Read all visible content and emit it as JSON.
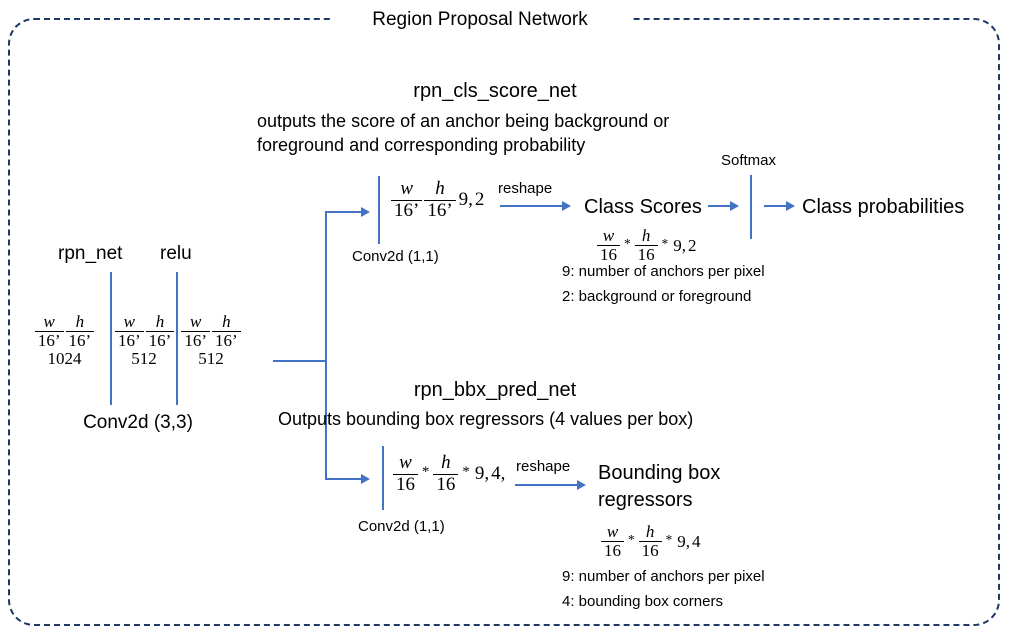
{
  "diagram": {
    "title": "Region Proposal Network",
    "type": "flow-diagram"
  },
  "backbone": {
    "labels": {
      "rpn_net": "rpn_net",
      "relu": "relu",
      "conv": "Conv2d (3,3)"
    },
    "stages": [
      {
        "name": "input-feature-map",
        "w_num": "w",
        "w_den": "16",
        "h_num": "h",
        "h_den": "16",
        "channels": "1024"
      },
      {
        "name": "rpn-net-output",
        "w_num": "w",
        "w_den": "16",
        "h_num": "h",
        "h_den": "16",
        "channels": "512"
      },
      {
        "name": "relu-output",
        "w_num": "w",
        "w_den": "16",
        "h_num": "h",
        "h_den": "16",
        "channels": "512"
      }
    ]
  },
  "cls_branch": {
    "heading": "rpn_cls_score_net",
    "description_line1": "outputs the score of an anchor being background or",
    "description_line2": "foreground and corresponding probability",
    "conv_label": "Conv2d (1,1)",
    "tensor": {
      "w_num": "w",
      "w_den": "16",
      "h_num": "h",
      "h_den": "16",
      "anchors": "9",
      "classes": "2",
      "sep": ","
    },
    "reshape_label": "reshape",
    "output_label": "Class Scores",
    "output_shape": {
      "w_num": "w",
      "w_den": "16",
      "h_num": "h",
      "h_den": "16",
      "op": "*",
      "anchors": "9",
      "classes": "2"
    },
    "note1": "9: number of anchors per pixel",
    "note2": "2: background or foreground",
    "softmax_label": "Softmax",
    "final_label": "Class probabilities"
  },
  "bbox_branch": {
    "heading": "rpn_bbx_pred_net",
    "description": "Outputs bounding box regressors  (4 values per box)",
    "conv_label": "Conv2d (1,1)",
    "tensor": {
      "w_num": "w",
      "w_den": "16",
      "h_num": "h",
      "h_den": "16",
      "op": "*",
      "anchors": "9",
      "coords": "4",
      "trailing": ","
    },
    "reshape_label": "reshape",
    "output_label_line1": "Bounding box",
    "output_label_line2": "regressors",
    "output_shape": {
      "w_num": "w",
      "w_den": "16",
      "h_num": "h",
      "h_den": "16",
      "op": "*",
      "anchors": "9",
      "coords": "4"
    },
    "note1": "9: number of anchors per pixel",
    "note2": "4: bounding box corners"
  },
  "colors": {
    "frame_border": "#1F3864",
    "connector": "#4472C4",
    "text": "#000000",
    "background": "#FFFFFF"
  }
}
